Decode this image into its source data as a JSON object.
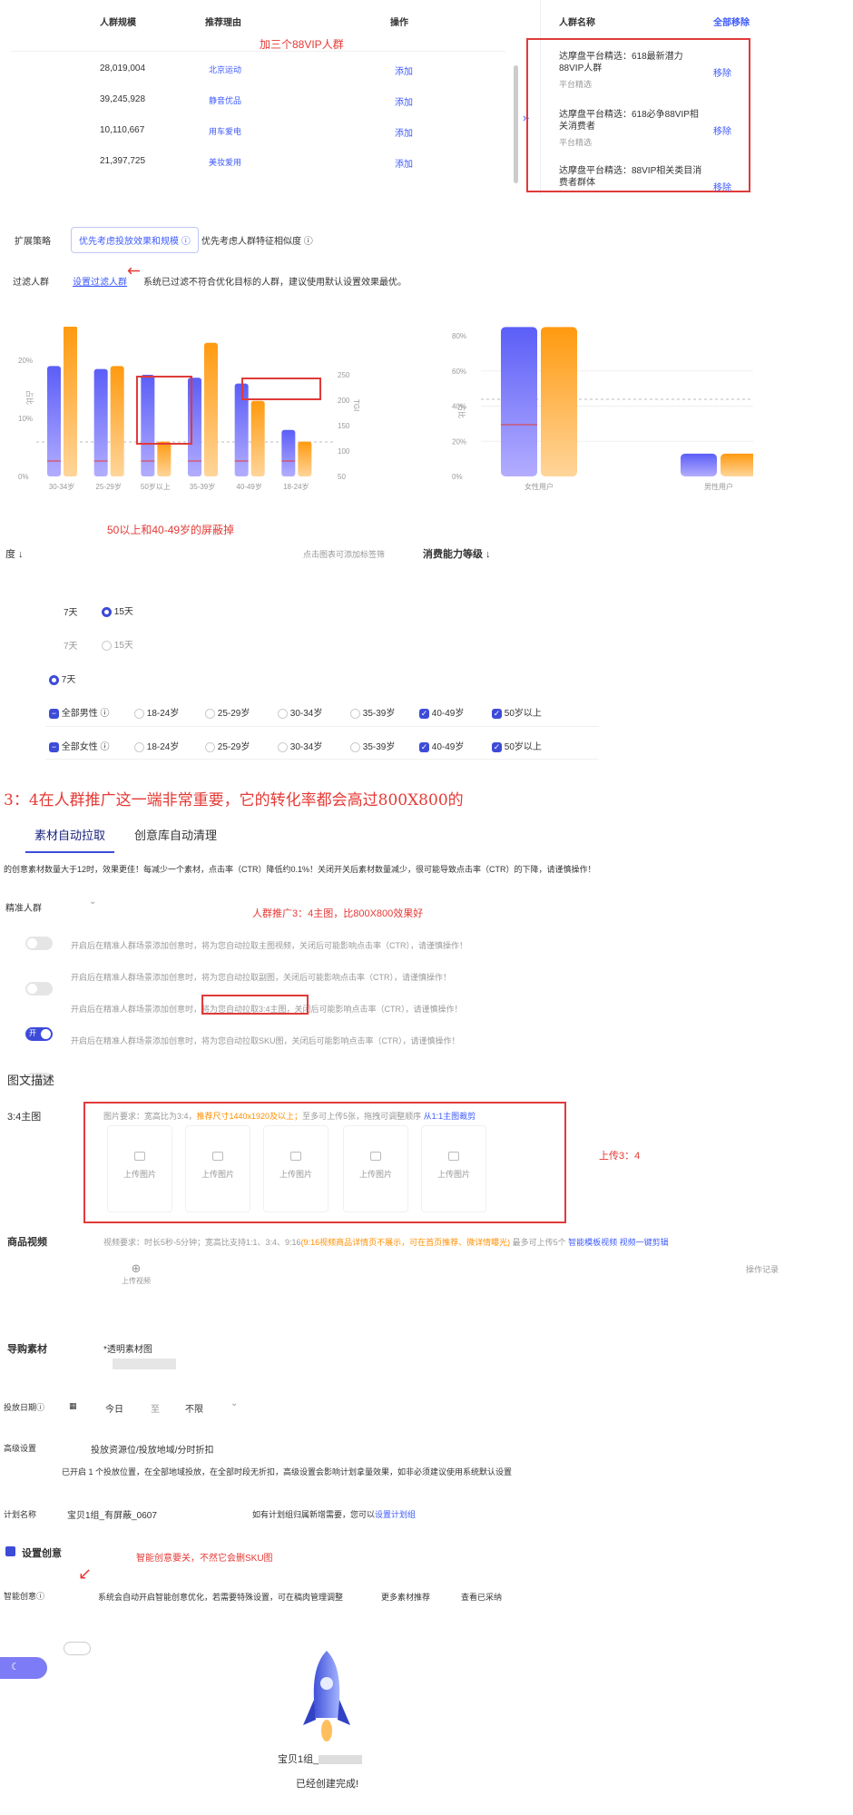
{
  "table": {
    "headers": [
      "人群规模",
      "推荐理由",
      "操作"
    ],
    "rows": [
      {
        "size": "28,019,004",
        "reason": "北京运动",
        "action": "添加"
      },
      {
        "size": "39,245,928",
        "reason": "静音优品",
        "action": "添加"
      },
      {
        "size": "10,110,667",
        "reason": "用车爱电",
        "action": "添加"
      },
      {
        "size": "21,397,725",
        "reason": "美妆爱用",
        "action": "添加"
      }
    ],
    "annotation": "加三个88VIP人群"
  },
  "selected": {
    "header": "人群名称",
    "remove_all": "全部移除",
    "items": [
      {
        "name": "达摩盘平台精选：618最新潜力88VIP人群",
        "source": "平台精选",
        "remove": "移除"
      },
      {
        "name": "达摩盘平台精选：618必争88VIP相关消费者",
        "source": "平台精选",
        "remove": "移除"
      },
      {
        "name": "达摩盘平台精选：88VIP相关类目消费者群体",
        "source": "",
        "remove": "移除"
      }
    ]
  },
  "strategy": {
    "label": "扩展策略",
    "opt1": "优先考虑投放效果和规模",
    "opt2": "优先考虑人群特征相似度"
  },
  "filter": {
    "label": "过滤人群",
    "link": "设置过滤人群",
    "desc": "系统已过滤不符合优化目标的人群，建议使用默认设置效果最优。"
  },
  "chart_annotation": "50以上和40-49岁的屏蔽掉",
  "chart_data": [
    {
      "type": "bar",
      "categories": [
        "30-34岁",
        "25-29岁",
        "50岁以上",
        "35-39岁",
        "40-49岁",
        "18-24岁"
      ],
      "series": [
        {
          "values": [
            19,
            18.5,
            17.5,
            17,
            16,
            8
          ]
        },
        {
          "values": [
            26,
            19,
            6,
            23,
            13,
            6
          ]
        }
      ],
      "ylim": [
        0,
        25
      ],
      "y_ticks_left": [
        "0%",
        "10%",
        "20%"
      ],
      "y_ticks_right": [
        "50",
        "100",
        "150",
        "200",
        "250"
      ],
      "ylabel": "占比",
      "ylabel_right": "TGI"
    },
    {
      "type": "bar",
      "categories": [
        "女性用户",
        "男性用户"
      ],
      "series": [
        {
          "values": [
            85,
            13
          ]
        },
        {
          "values": [
            85,
            13
          ]
        }
      ],
      "ylim": [
        0,
        80
      ],
      "y_ticks": [
        "0%",
        "20%",
        "40%",
        "60%",
        "80%"
      ],
      "ylabel": "占比"
    }
  ],
  "filters": {
    "sort1": "度 ↓",
    "hint": "点击图表可添加标签筛",
    "sort2": "消费能力等级 ↓",
    "days7": "7天",
    "days15": "15天",
    "male": {
      "all": "全部男性",
      "ages": [
        "18-24岁",
        "25-29岁",
        "30-34岁",
        "35-39岁",
        "40-49岁",
        "50岁以上"
      ]
    },
    "female": {
      "all": "全部女性",
      "ages": [
        "18-24岁",
        "25-29岁",
        "30-34岁",
        "35-39岁",
        "40-49岁",
        "50岁以上"
      ]
    }
  },
  "banner": "3：4在人群推广这一端非常重要，它的转化率都会高过800X800的",
  "tabs": [
    "素材自动拉取",
    "创意库自动清理"
  ],
  "tip": "的创意素材数量大于12时，效果更佳！每减少一个素材，点击率（CTR）降低约0.1%！关闭开关后素材数量减少，很可能导致点击率（CTR）的下降，请谨慎操作！",
  "audience_select": "精准人群",
  "annotation2": "人群推广3：4主图，比800X800效果好",
  "toggle_rows": [
    "开启后在精准人群场景添加创意时，将为您自动拉取主图视频，关闭后可能影响点击率（CTR），请谨慎操作！",
    "开启后在精准人群场景添加创意时，将为您自动拉取副图，关闭后可能影响点击率（CTR），请谨慎操作！",
    "开启后在精准人群场景添加创意时，将为您自动拉取3:4主图，关闭后可能影响点击率（CTR），请谨慎操作！",
    "开启后在精准人群场景添加创意时，将为您自动拉取SKU图，关闭后可能影响点击率（CTR），请谨慎操作！"
  ],
  "toggle_on_label": "开",
  "section_title": "图文描述",
  "main34": {
    "label": "3:4主图",
    "req1": "图片要求：宽高比为3:4，",
    "req2": "推荐尺寸1440x1920及以上；",
    "req3": "至多可上传5张，拖拽可调整顺序",
    "link": "从1:1主图裁剪",
    "upload": "上传图片",
    "annotation": "上传3：4"
  },
  "video": {
    "label": "商品视频",
    "req": "视频要求：时长5秒-5分钟；宽高比支持1:1、3:4、9:16",
    "req_orange": "(9:16视频商品详情页不展示，可在首页推荐、微详情曝光)",
    "more": "最多可上传5个",
    "link1": "智能模板视频",
    "link2": "视频一键剪辑",
    "upload": "上传视频",
    "op": "操作记录"
  },
  "guide": {
    "label": "导购素材",
    "req": "*透明素材图"
  },
  "date": {
    "label": "投放日期",
    "start": "今日",
    "sep": "至",
    "end": "不限"
  },
  "advanced": {
    "label": "高级设置",
    "value": "投放资源位/投放地域/分时折扣",
    "desc": "已开启 1 个投放位置，在全部地域投放，在全部时段无折扣，高级设置会影响计划拿量效果，如非必须建议使用系统默认设置"
  },
  "plan": {
    "label": "计划名称",
    "value": "宝贝1组_有屏蔽_0607",
    "hint": "如有计划组归属新增需要，您可以",
    "link": "设置计划组"
  },
  "creative": {
    "title": "设置创意",
    "label": "智能创意",
    "desc": "系统会自动开启智能创意优化，若需要特殊设置，可在稿肉管理调整",
    "link1": "更多素材推荐",
    "link2": "查看已采纳",
    "annotation": "智能创意要关，不然它会删SKU图"
  },
  "done": {
    "name": "宝贝1组_",
    "msg": "已经创建完成!"
  }
}
